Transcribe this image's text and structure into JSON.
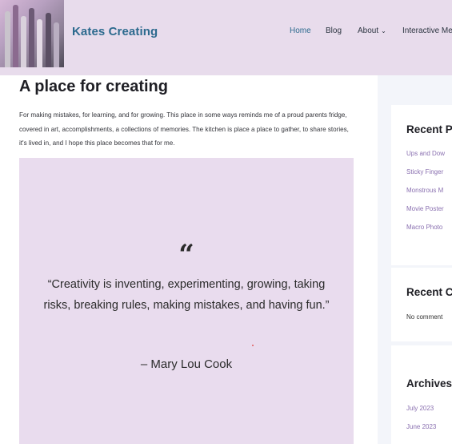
{
  "header": {
    "site_title": "Kates Creating",
    "nav": {
      "home": "Home",
      "blog": "Blog",
      "about": "About",
      "interactive": "Interactive Me"
    }
  },
  "main": {
    "title": "A place for creating",
    "intro": "For making mistakes, for learning, and for growing. This place in some ways reminds me of a proud parents fridge, covered in art, accomplishments, a collections of memories. The kitchen is place a place to gather, to share stories, it's lived in, and I hope this place becomes that for me.",
    "quote_mark": "“",
    "quote": "“Creativity is inventing, experimenting, growing, taking risks, breaking rules, making mistakes, and having fun.”",
    "author": "– Mary Lou Cook"
  },
  "sidebar": {
    "recent_posts": {
      "title": "Recent P",
      "items": [
        "Ups and Dow",
        "Sticky Finger",
        "Monstrous M",
        "Movie Poster",
        "Macro Photo"
      ]
    },
    "recent_comments": {
      "title": "Recent C",
      "text": "No comment"
    },
    "archives": {
      "title": "Archives",
      "items": [
        "July 2023",
        "June 2023"
      ]
    }
  },
  "colors": {
    "header_bg": "#e8dcec",
    "quote_bg": "#e9dcee",
    "title_blue": "#2c6a8e",
    "link_purple": "#8a70b0",
    "sidebar_bg": "#f3f5fa"
  }
}
